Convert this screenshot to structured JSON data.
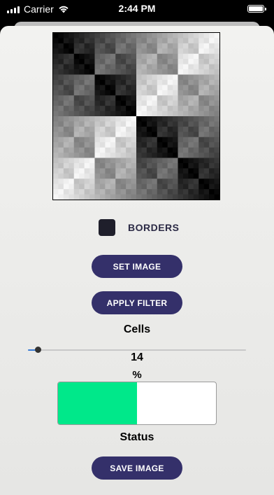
{
  "status_bar": {
    "carrier": "Carrier",
    "time": "2:44 PM",
    "wifi_icon": "wifi-icon",
    "battery_icon": "battery-icon"
  },
  "colors": {
    "accent_button": "#34306a",
    "progress_fill": "#00e88a",
    "checkbox": "#1f1f2b"
  },
  "image": {
    "description_icon": "fractal-grid-image"
  },
  "options": {
    "borders_label": "BORDERS",
    "borders_checked": false
  },
  "buttons": {
    "set_image": "SET IMAGE",
    "apply_filter": "APPLY FILTER",
    "save_image": "SAVE IMAGE"
  },
  "cells": {
    "label": "Cells",
    "value": "14",
    "slider_fraction": 0.03
  },
  "progress": {
    "unit_label": "%",
    "fraction": 0.5,
    "status_label": "Status"
  }
}
